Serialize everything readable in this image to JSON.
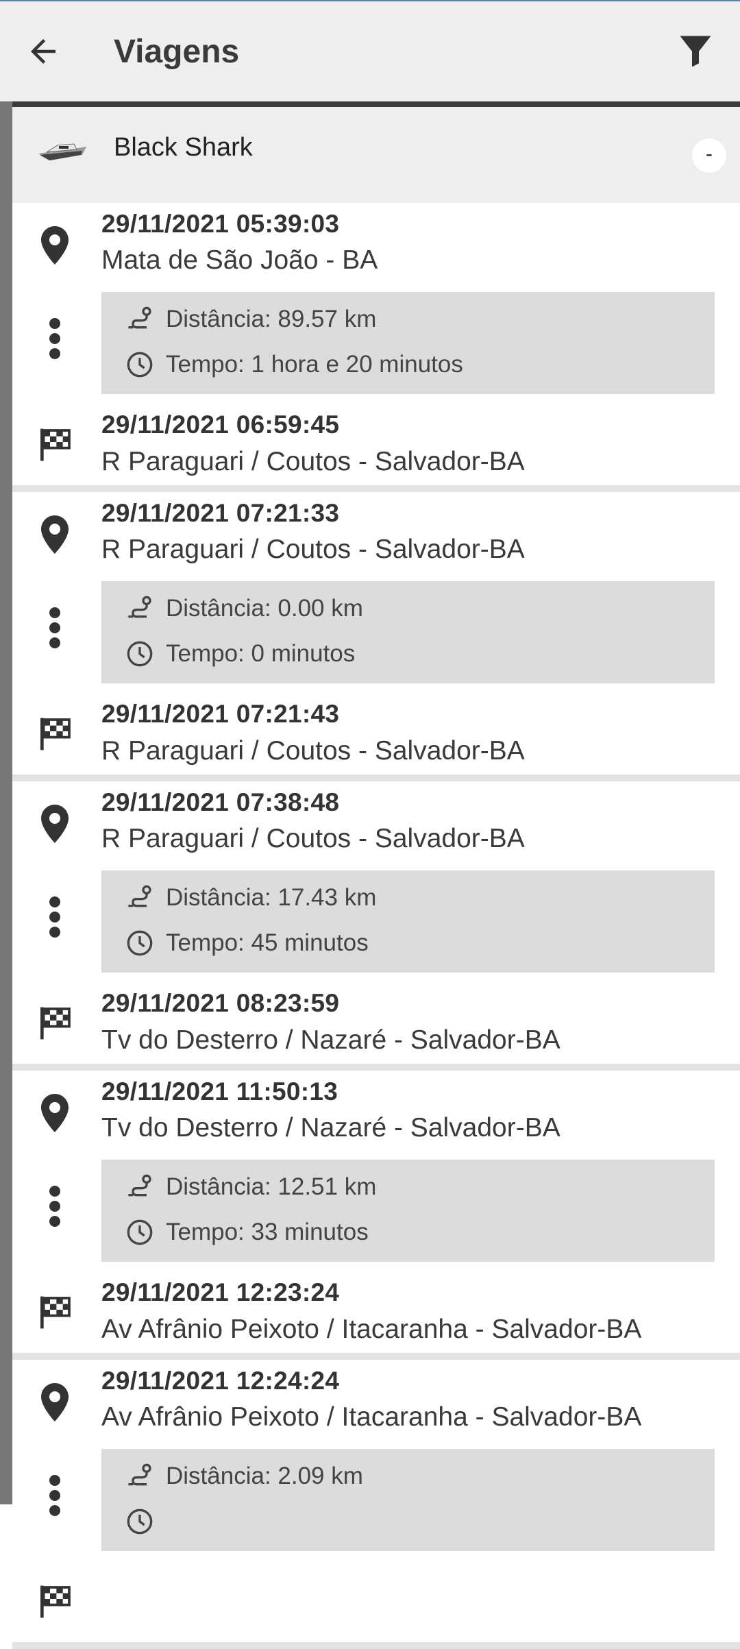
{
  "appbar": {
    "title": "Viagens",
    "back_icon": "arrow-left-icon",
    "filter_icon": "filter-icon"
  },
  "vehicle": {
    "name": "Black Shark",
    "toggle_label": "-",
    "thumbnail_icon": "boat-icon"
  },
  "trips": [
    {
      "start_datetime": "29/11/2021 05:39:03",
      "start_address": "Mata de São João - BA",
      "distance": "Distância: 89.57 km",
      "duration": "Tempo: 1 hora e 20 minutos",
      "end_datetime": "29/11/2021 06:59:45",
      "end_address": "R Paraguari / Coutos - Salvador-BA"
    },
    {
      "start_datetime": "29/11/2021 07:21:33",
      "start_address": "R Paraguari / Coutos - Salvador-BA",
      "distance": "Distância: 0.00 km",
      "duration": "Tempo: 0 minutos",
      "end_datetime": "29/11/2021 07:21:43",
      "end_address": "R Paraguari / Coutos - Salvador-BA"
    },
    {
      "start_datetime": "29/11/2021 07:38:48",
      "start_address": "R Paraguari / Coutos - Salvador-BA",
      "distance": "Distância: 17.43 km",
      "duration": "Tempo: 45 minutos",
      "end_datetime": "29/11/2021 08:23:59",
      "end_address": "Tv do Desterro / Nazaré - Salvador-BA"
    },
    {
      "start_datetime": "29/11/2021 11:50:13",
      "start_address": "Tv do Desterro / Nazaré - Salvador-BA",
      "distance": "Distância: 12.51 km",
      "duration": "Tempo: 33 minutos",
      "end_datetime": "29/11/2021 12:23:24",
      "end_address": "Av Afrânio Peixoto / Itacaranha - Salvador-BA"
    },
    {
      "start_datetime": "29/11/2021 12:24:24",
      "start_address": "Av Afrânio Peixoto / Itacaranha - Salvador-BA",
      "distance": "Distância: 2.09 km",
      "duration": "",
      "end_datetime": "",
      "end_address": ""
    }
  ],
  "icons": {
    "start": "map-pin-icon",
    "middle": "more-vertical-icon",
    "end": "checkered-flag-icon",
    "distance": "route-icon",
    "duration": "clock-icon"
  },
  "colors": {
    "appbar_bg": "#eeeeee",
    "rail": "#777777",
    "info_bg": "#dcdcdc",
    "separator": "#e3e3e3"
  }
}
